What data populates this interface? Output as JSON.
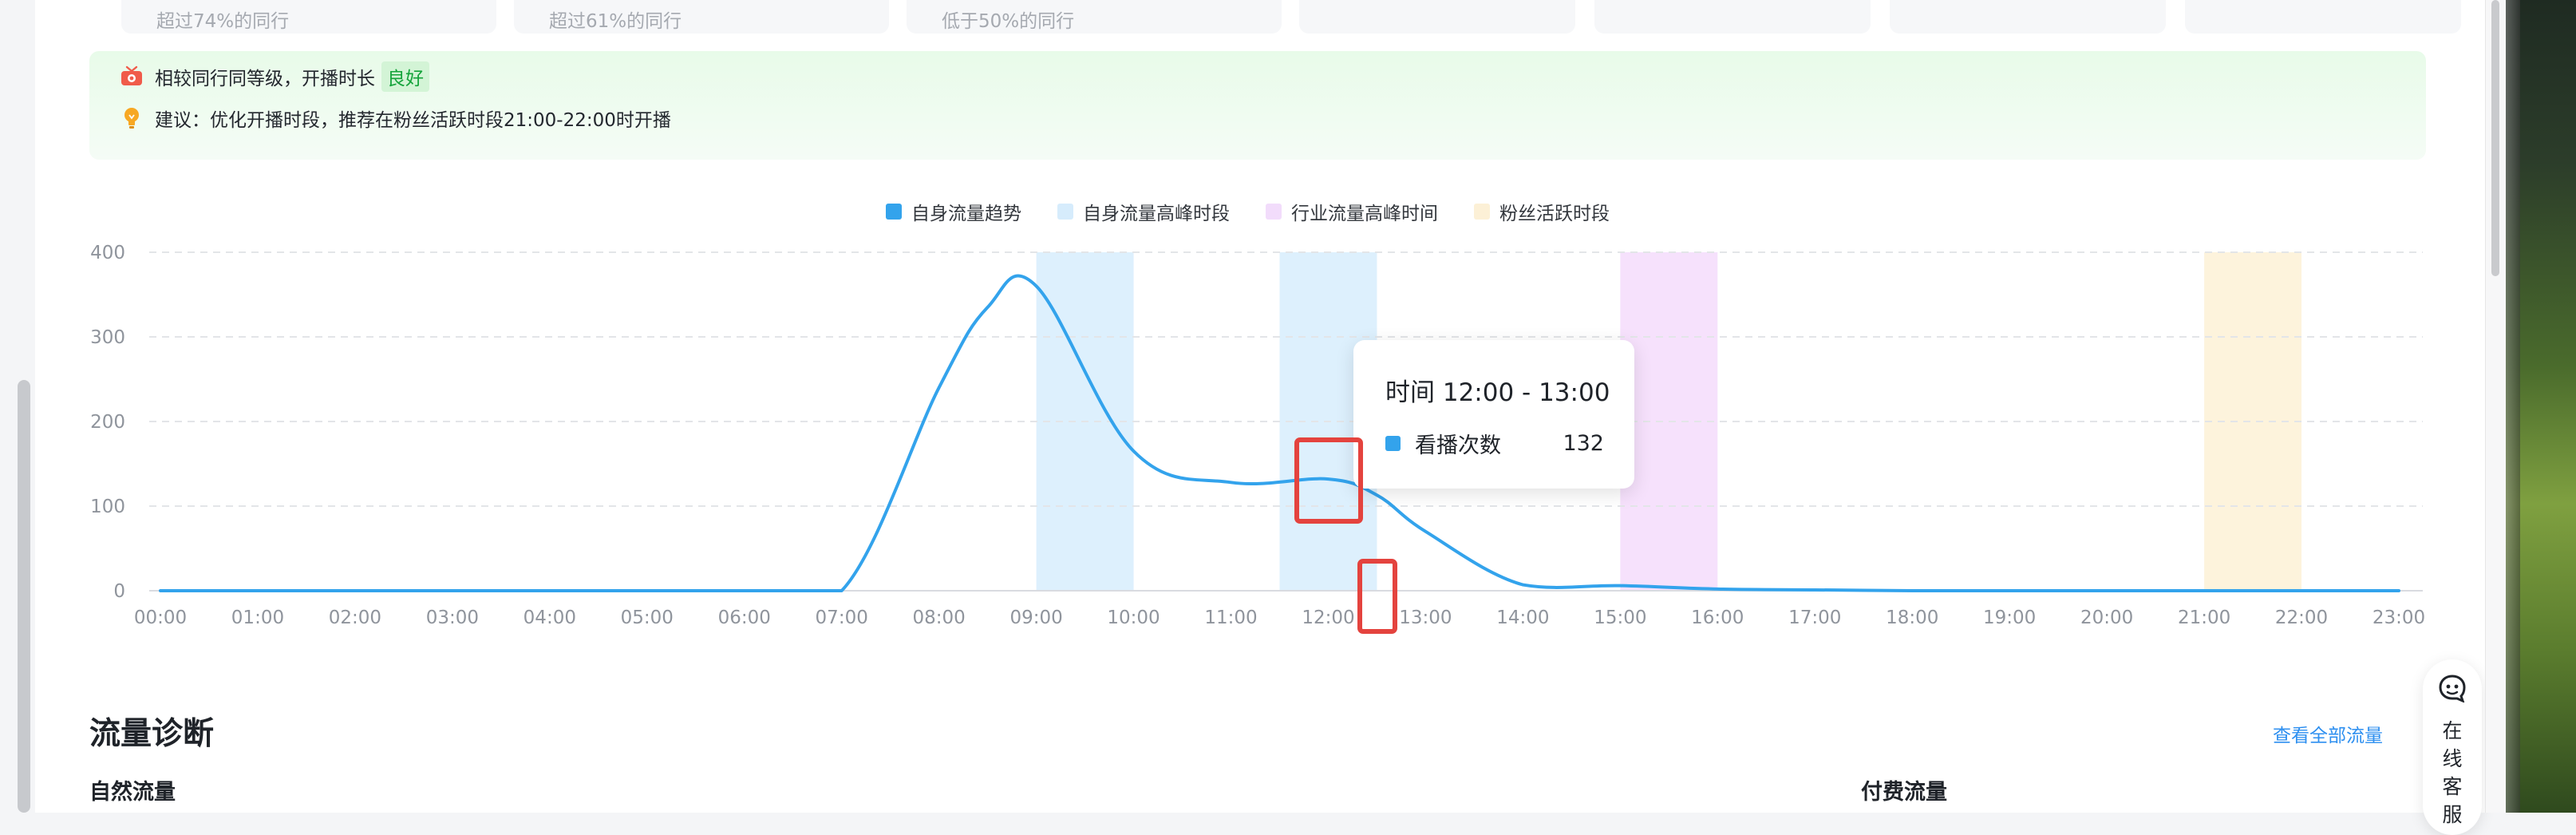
{
  "metric_cards": [
    {
      "text": "超过74%的同行"
    },
    {
      "text": "超过61%的同行"
    },
    {
      "text": "低于50%的同行"
    },
    {
      "text": ""
    },
    {
      "text": ""
    },
    {
      "text": ""
    },
    {
      "text": ""
    }
  ],
  "notice": {
    "row1_text": "相较同行同等级，开播时长",
    "row1_badge": "良好",
    "row2_text": "建议：优化开播时段，推荐在粉丝活跃时段21:00-22:00时开播"
  },
  "colors": {
    "trend": "#33a3ec",
    "self_peak": "#ddf0fd",
    "industry_peak": "#f6e1fc",
    "fans_active": "#fdf3dc",
    "badge_text": "#14a33a",
    "marker": "#e4433e",
    "link": "#2d8ff0"
  },
  "chart_data": {
    "type": "line",
    "legend_position": "top-center",
    "grid": true,
    "legend": [
      {
        "label": "自身流量趋势",
        "color": "#33a3ec"
      },
      {
        "label": "自身流量高峰时段",
        "color": "#d6ecfc"
      },
      {
        "label": "行业流量高峰时间",
        "color": "#f2dcfb"
      },
      {
        "label": "粉丝活跃时段",
        "color": "#fcf0d6"
      }
    ],
    "categories": [
      "00:00",
      "01:00",
      "02:00",
      "03:00",
      "04:00",
      "05:00",
      "06:00",
      "07:00",
      "08:00",
      "09:00",
      "10:00",
      "11:00",
      "12:00",
      "13:00",
      "14:00",
      "15:00",
      "16:00",
      "17:00",
      "18:00",
      "19:00",
      "20:00",
      "21:00",
      "22:00",
      "23:00"
    ],
    "yticks": [
      0,
      100,
      200,
      300,
      400
    ],
    "ylim": [
      0,
      400
    ],
    "series": [
      {
        "name": "看播次数",
        "x": [
          0,
          1,
          2,
          3,
          4,
          5,
          6,
          7,
          8,
          8.5,
          9,
          10,
          11,
          12,
          12.5,
          13,
          14,
          15,
          16,
          17,
          18,
          19,
          20,
          21,
          22,
          23
        ],
        "values": [
          0,
          0,
          0,
          0,
          0,
          0,
          0,
          0,
          240,
          335,
          360,
          165,
          128,
          132,
          113,
          70,
          7,
          6,
          2,
          1,
          0,
          0,
          0,
          0,
          0,
          0
        ]
      }
    ],
    "bands": [
      {
        "type": "self_peak",
        "start": 9,
        "end": 10
      },
      {
        "type": "self_peak",
        "start": 11.5,
        "end": 12.5
      },
      {
        "type": "industry_peak",
        "start": 15,
        "end": 16
      },
      {
        "type": "fans_active",
        "start": 21,
        "end": 22
      }
    ]
  },
  "tooltip": {
    "title": "时间 12:00 - 13:00",
    "series_label": "看播次数",
    "value": "132"
  },
  "section": {
    "title": "流量诊断",
    "view_all": "查看全部流量",
    "natural_label": "自然流量",
    "paid_label": "付费流量"
  },
  "service": {
    "chars": [
      "在",
      "线",
      "客",
      "服"
    ]
  }
}
